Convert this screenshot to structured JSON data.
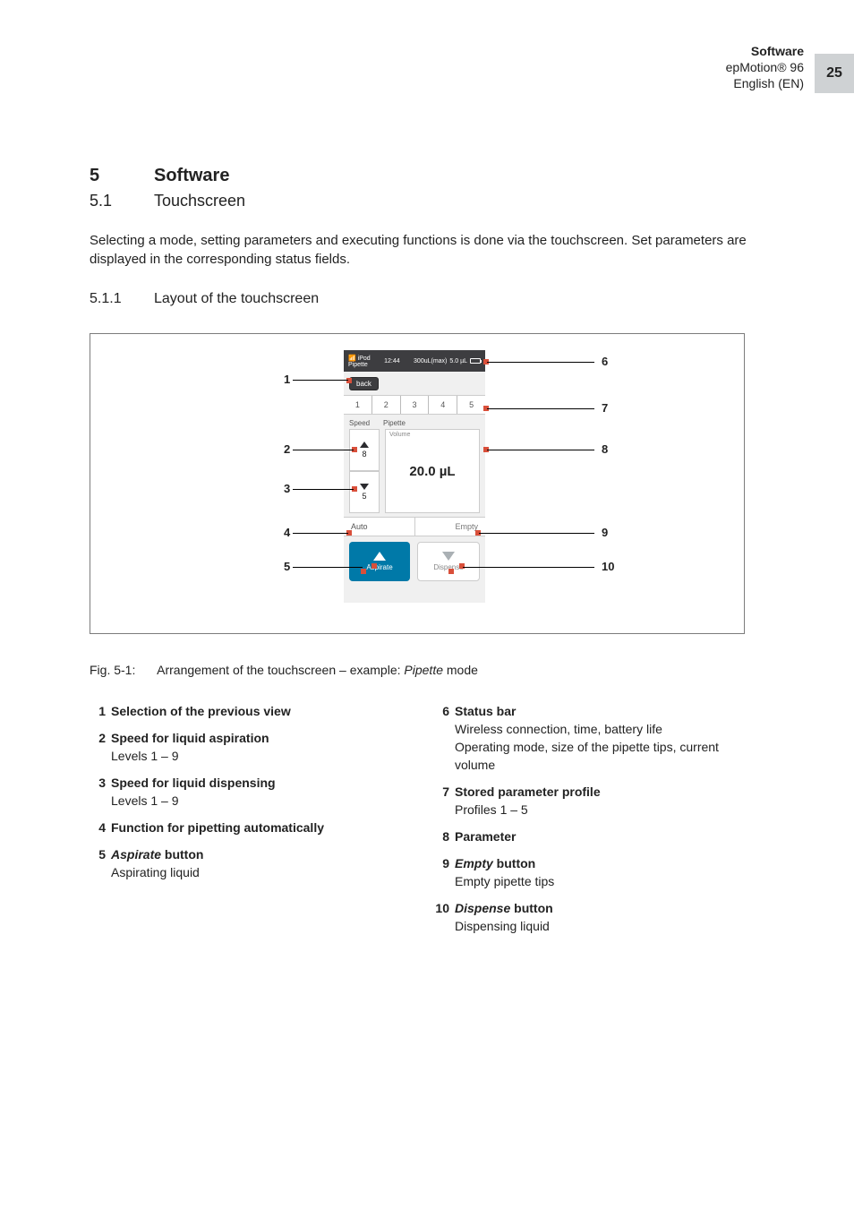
{
  "header": {
    "l1": "Software",
    "l2": "epMotion® 96",
    "l3": "English (EN)",
    "page": "25"
  },
  "h5": {
    "num": "5",
    "txt": "Software"
  },
  "h51": {
    "num": "5.1",
    "txt": "Touchscreen"
  },
  "para1": "Selecting a mode, setting parameters and executing functions is done via the touchscreen. Set parameters are displayed in the corresponding status fields.",
  "h511": {
    "num": "5.1.1",
    "txt": "Layout of the touchscreen"
  },
  "ts": {
    "status": {
      "left1": "iPod",
      "left2": "Pipette",
      "time": "12:44",
      "tips": "300uL(max)",
      "vol": "5.0 µL"
    },
    "back": "back",
    "tabs": [
      "1",
      "2",
      "3",
      "4",
      "5"
    ],
    "labels": {
      "speed": "Speed",
      "pipette": "Pipette",
      "volume": "Volume"
    },
    "speed_up": "8",
    "speed_dn": "5",
    "volume": "20.0 µL",
    "auto": "Auto",
    "empty": "Empty",
    "aspirate": "Aspirate",
    "dispense": "Dispense"
  },
  "callouts_left": {
    "1": "1",
    "2": "2",
    "3": "3",
    "4": "4",
    "5": "5"
  },
  "callouts_right": {
    "6": "6",
    "7": "7",
    "8": "8",
    "9": "9",
    "10": "10"
  },
  "figcap": {
    "fn": "Fig. 5-1:",
    "txt_a": "Arrangement of the touchscreen – example: ",
    "txt_i": "Pipette",
    "txt_b": " mode"
  },
  "legend_left": [
    {
      "n": "1",
      "t": "Selection of the previous view",
      "d": ""
    },
    {
      "n": "2",
      "t": "Speed for liquid aspiration",
      "d": "Levels 1 – 9"
    },
    {
      "n": "3",
      "t": "Speed for liquid dispensing",
      "d": "Levels 1 – 9"
    },
    {
      "n": "4",
      "t": "Function for pipetting automatically",
      "d": ""
    },
    {
      "n": "5",
      "t_html": "aspirate",
      "t_suffix": " button",
      "d": "Aspirating liquid"
    }
  ],
  "legend_right": [
    {
      "n": "6",
      "t": "Status bar",
      "d": "Wireless connection, time, battery life\nOperating mode, size of the pipette tips, current volume"
    },
    {
      "n": "7",
      "t": "Stored parameter profile",
      "d": "Profiles 1 – 5"
    },
    {
      "n": "8",
      "t": "Parameter",
      "d": ""
    },
    {
      "n": "9",
      "t_html": "empty",
      "t_suffix": " button",
      "d": "Empty pipette tips"
    },
    {
      "n": "10",
      "t_html": "dispense",
      "t_suffix": " button",
      "d": "Dispensing liquid"
    }
  ]
}
